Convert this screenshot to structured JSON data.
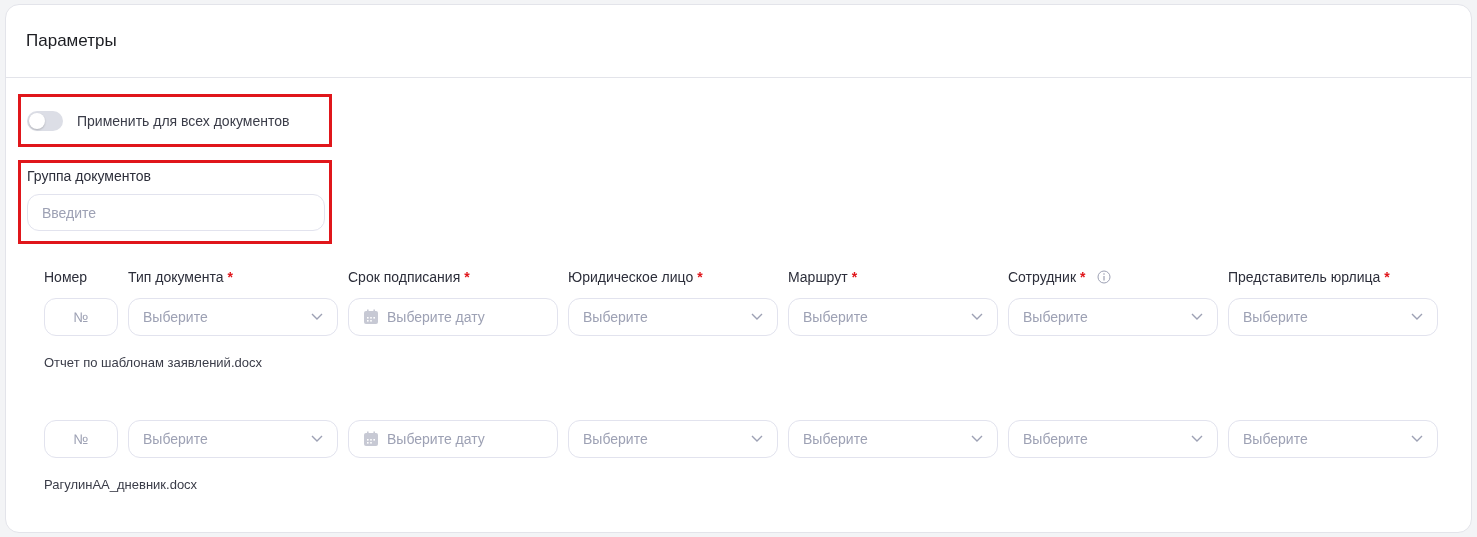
{
  "title": "Параметры",
  "apply_all": {
    "label": "Применить для всех документов",
    "on": false,
    "highlighted": true
  },
  "group": {
    "label": "Группа документов",
    "placeholder": "Введите",
    "highlighted": true
  },
  "columns": [
    {
      "label": "Номер",
      "required": false,
      "info": false,
      "kind": "number"
    },
    {
      "label": "Тип документа",
      "required": true,
      "info": false,
      "kind": "select"
    },
    {
      "label": "Срок подписания",
      "required": true,
      "info": false,
      "kind": "date"
    },
    {
      "label": "Юридическое лицо",
      "required": true,
      "info": false,
      "kind": "select"
    },
    {
      "label": "Маршрут",
      "required": true,
      "info": false,
      "kind": "select"
    },
    {
      "label": "Сотрудник",
      "required": true,
      "info": true,
      "kind": "select"
    },
    {
      "label": "Представитель юрлица",
      "required": true,
      "info": false,
      "kind": "select"
    }
  ],
  "required_mark": "*",
  "rows": [
    {
      "cells": [
        "№",
        "Выберите",
        "Выберите дату",
        "Выберите",
        "Выберите",
        "Выберите",
        "Выберите"
      ],
      "file_name": "Отчет по шаблонам заявлений.docx"
    },
    {
      "cells": [
        "№",
        "Выберите",
        "Выберите дату",
        "Выберите",
        "Выберите",
        "Выберите",
        "Выберите"
      ],
      "file_name": "РагулинАА_дневник.docx"
    }
  ]
}
